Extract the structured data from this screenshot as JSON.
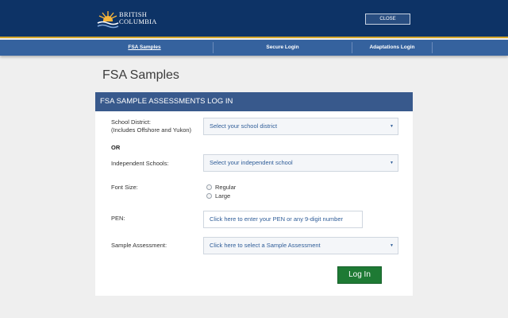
{
  "header": {
    "logo_line1": "BRITISH",
    "logo_line2": "COLUMBIA",
    "close_label": "CLOSE"
  },
  "nav": {
    "items": [
      {
        "label": "FSA Samples"
      },
      {
        "label": "Secure Login"
      },
      {
        "label": "Adaptations Login"
      }
    ]
  },
  "page": {
    "title": "FSA Samples"
  },
  "form": {
    "header": "FSA SAMPLE ASSESSMENTS LOG IN",
    "school_district_label_1": "School District:",
    "school_district_label_2": "(Includes Offshore and Yukon)",
    "school_district_value": "Select your school district",
    "or_label": "OR",
    "independent_label": "Independent Schools:",
    "independent_value": "Select your independent school",
    "font_size_label": "Font Size:",
    "font_options": [
      "Regular",
      "Large"
    ],
    "pen_label": "PEN:",
    "pen_placeholder": "Click here to enter your PEN or any 9-digit number",
    "sample_label": "Sample Assessment:",
    "sample_value": "Click here to select a Sample Assessment",
    "login_label": "Log In"
  },
  "colors": {
    "header_bg": "#0d3366",
    "nav_bg": "#35629e",
    "panel_header_bg": "#38598c",
    "login_bg": "#1e7a34",
    "accent_gold": "#d4a72c"
  }
}
